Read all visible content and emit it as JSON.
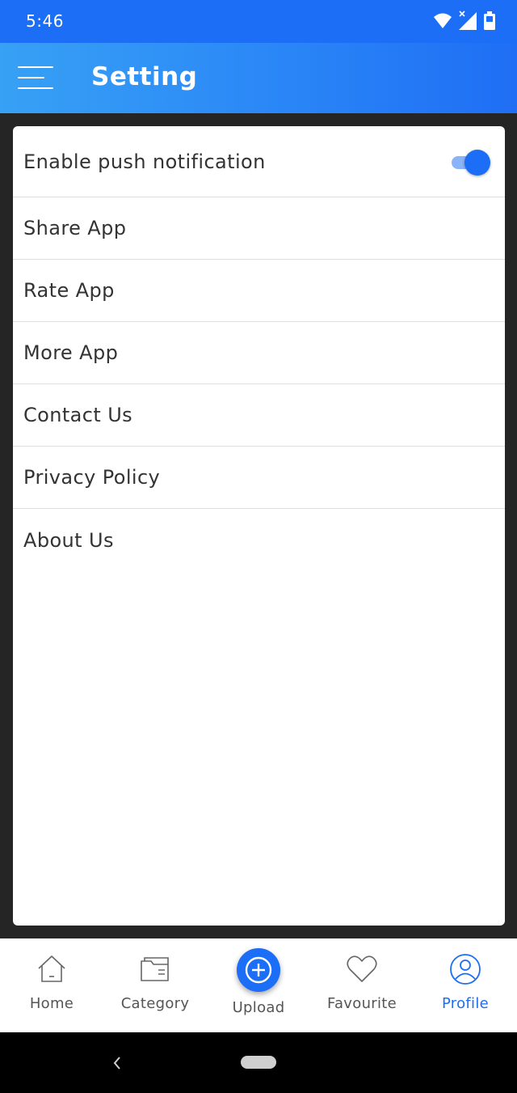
{
  "status_bar": {
    "time": "5:46",
    "icons": [
      "wifi-icon",
      "signal-icon",
      "battery-icon"
    ]
  },
  "app_bar": {
    "title": "Setting",
    "menu_icon": "hamburger-menu-icon"
  },
  "settings": {
    "push_label": "Enable push notification",
    "push_enabled": true,
    "items": [
      {
        "label": "Share App"
      },
      {
        "label": "Rate App"
      },
      {
        "label": "More App"
      },
      {
        "label": "Contact Us"
      },
      {
        "label": "Privacy Policy"
      },
      {
        "label": "About Us"
      }
    ]
  },
  "bottom_nav": {
    "items": [
      {
        "label": "Home",
        "icon": "home-icon"
      },
      {
        "label": "Category",
        "icon": "folder-icon"
      },
      {
        "label": "Upload",
        "icon": "plus-circle-icon"
      },
      {
        "label": "Favourite",
        "icon": "heart-icon"
      },
      {
        "label": "Profile",
        "icon": "profile-icon",
        "active": true
      }
    ]
  },
  "colors": {
    "primary": "#1b6ef5",
    "app_bar_start": "#37a1f5",
    "background": "#252525",
    "text": "#333333",
    "toggle_track": "#8ab4f8"
  }
}
